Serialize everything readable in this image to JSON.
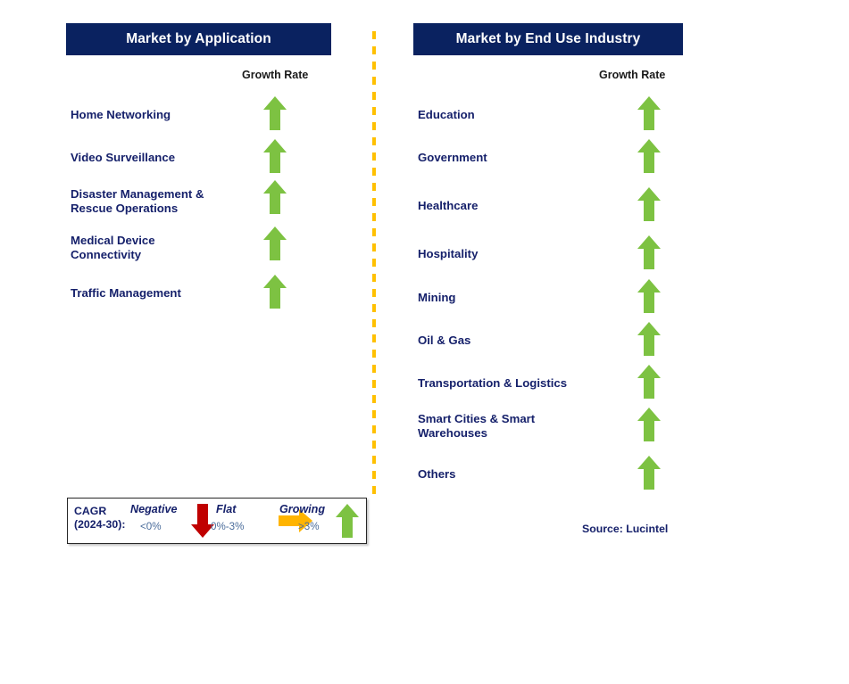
{
  "columns": {
    "left": {
      "title": "Market by Application",
      "growth_caption": "Growth Rate",
      "items": [
        {
          "label": "Home Networking",
          "growth": "growing"
        },
        {
          "label": "Video Surveillance",
          "growth": "growing"
        },
        {
          "label": "Disaster Management &\nRescue Operations",
          "growth": "growing"
        },
        {
          "label": "Medical Device\nConnectivity",
          "growth": "growing"
        },
        {
          "label": "Traffic Management",
          "growth": "growing"
        }
      ]
    },
    "right": {
      "title": "Market by End Use Industry",
      "growth_caption": "Growth Rate",
      "items": [
        {
          "label": "Education",
          "growth": "growing"
        },
        {
          "label": "Government",
          "growth": "growing"
        },
        {
          "label": "Healthcare",
          "growth": "growing"
        },
        {
          "label": "Hospitality",
          "growth": "growing"
        },
        {
          "label": "Mining",
          "growth": "growing"
        },
        {
          "label": "Oil & Gas",
          "growth": "growing"
        },
        {
          "label": "Transportation & Logistics",
          "growth": "growing"
        },
        {
          "label": "Smart Cities & Smart\nWarehouses",
          "growth": "growing"
        },
        {
          "label": "Others",
          "growth": "growing"
        }
      ]
    }
  },
  "legend": {
    "title": "CAGR\n(2024-30):",
    "entries": [
      {
        "word": "Negative",
        "range": "<0%",
        "icon": "arrow-down-icon",
        "color": "#C00000"
      },
      {
        "word": "Flat",
        "range": "0%-3%",
        "icon": "arrow-right-icon",
        "color": "#FFB400"
      },
      {
        "word": "Growing",
        "range": ">3%",
        "icon": "arrow-up-icon",
        "color": "#7DC242"
      }
    ]
  },
  "source": "Source: Lucintel",
  "colors": {
    "header_navy": "#0A2260",
    "label_navy": "#16216B",
    "growth_green": "#7DC242",
    "negative_red": "#C00000",
    "flat_orange": "#FFB400",
    "divider_orange": "#FFC000"
  }
}
